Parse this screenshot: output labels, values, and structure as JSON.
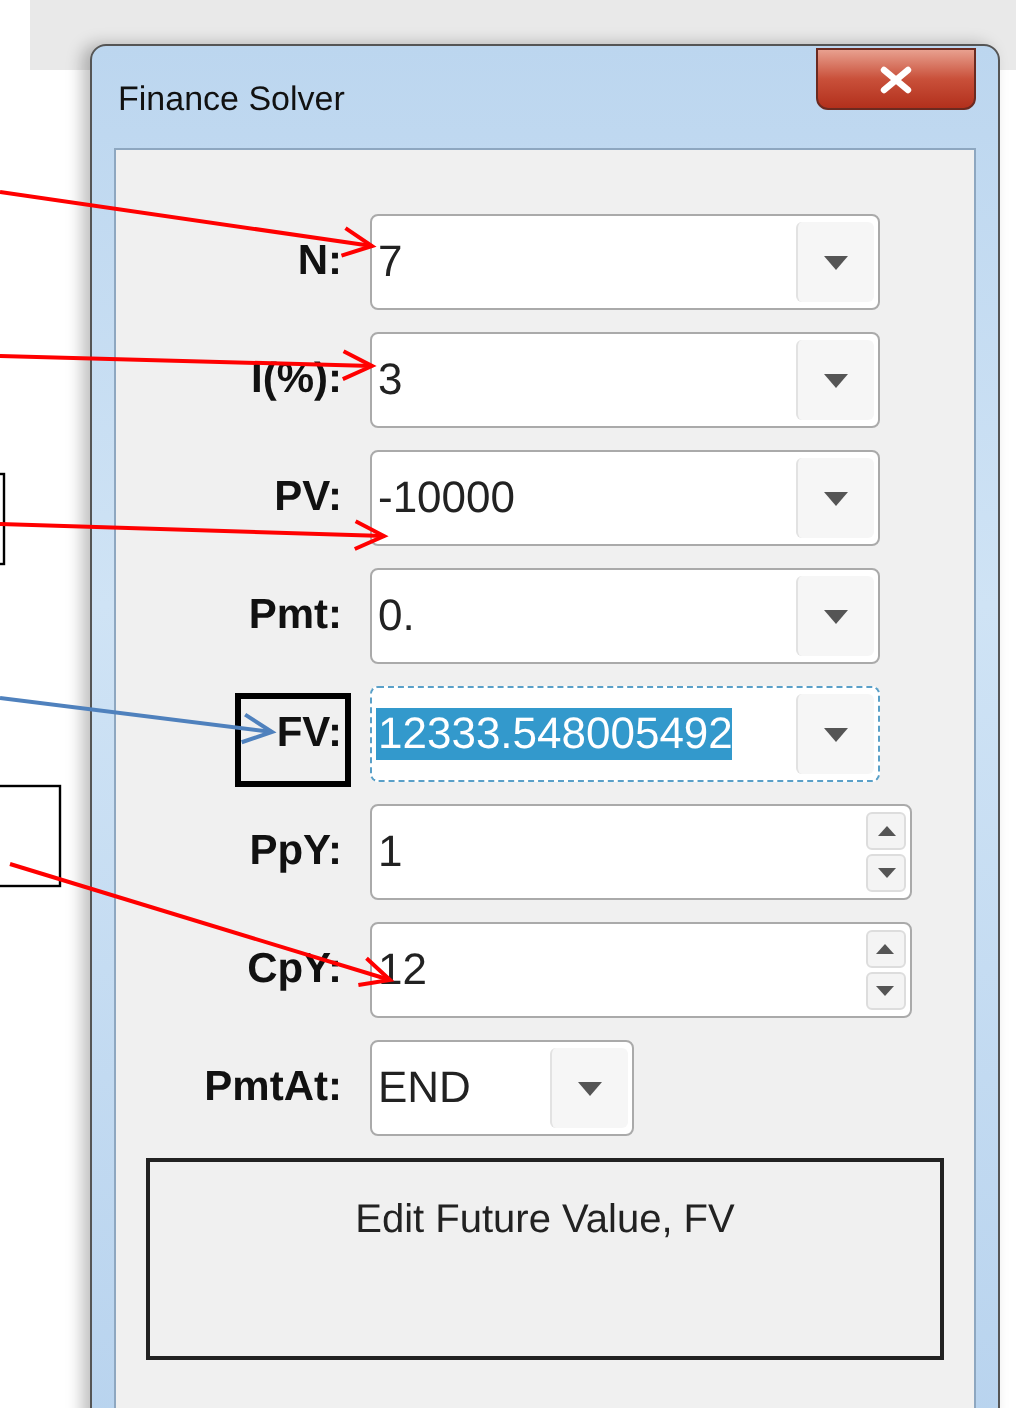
{
  "window": {
    "title": "Finance Solver"
  },
  "fields": [
    {
      "label": "N:",
      "value": "7",
      "kind": "dropdown",
      "focused": false
    },
    {
      "label": "I(%):",
      "value": "3",
      "kind": "dropdown",
      "focused": false
    },
    {
      "label": "PV:",
      "value": "-10000",
      "kind": "dropdown",
      "focused": false
    },
    {
      "label": "Pmt:",
      "value": "0.",
      "kind": "dropdown",
      "focused": false
    },
    {
      "label": "FV:",
      "value": "12333.548005492",
      "kind": "dropdown",
      "focused": true
    },
    {
      "label": "PpY:",
      "value": "1",
      "kind": "spin",
      "focused": false
    },
    {
      "label": "CpY:",
      "value": "12",
      "kind": "spin",
      "focused": false
    },
    {
      "label": "PmtAt:",
      "value": "END",
      "kind": "choice",
      "focused": false
    }
  ],
  "status": "Edit Future Value, FV",
  "annotation_arrows": [
    {
      "color": "#ff0000"
    },
    {
      "color": "#ff0000"
    },
    {
      "color": "#ff0000"
    },
    {
      "color": "#4f81bd"
    },
    {
      "color": "#ff0000"
    }
  ]
}
